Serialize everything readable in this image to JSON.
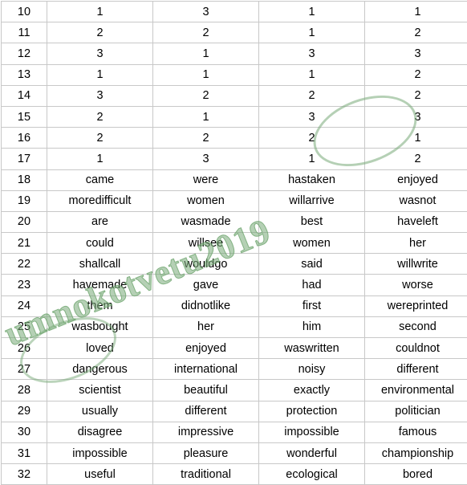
{
  "table": {
    "column_count": 5,
    "rows": [
      {
        "num": "10",
        "c1": "1",
        "c2": "3",
        "c3": "1",
        "c4": "1"
      },
      {
        "num": "11",
        "c1": "2",
        "c2": "2",
        "c3": "1",
        "c4": "2"
      },
      {
        "num": "12",
        "c1": "3",
        "c2": "1",
        "c3": "3",
        "c4": "3"
      },
      {
        "num": "13",
        "c1": "1",
        "c2": "1",
        "c3": "1",
        "c4": "2"
      },
      {
        "num": "14",
        "c1": "3",
        "c2": "2",
        "c3": "2",
        "c4": "2"
      },
      {
        "num": "15",
        "c1": "2",
        "c2": "1",
        "c3": "3",
        "c4": "3"
      },
      {
        "num": "16",
        "c1": "2",
        "c2": "2",
        "c3": "2",
        "c4": "1"
      },
      {
        "num": "17",
        "c1": "1",
        "c2": "3",
        "c3": "1",
        "c4": "2"
      },
      {
        "num": "18",
        "c1": "came",
        "c2": "were",
        "c3": "hastaken",
        "c4": "enjoyed"
      },
      {
        "num": "19",
        "c1": "moredifficult",
        "c2": "women",
        "c3": "willarrive",
        "c4": "wasnot"
      },
      {
        "num": "20",
        "c1": "are",
        "c2": "wasmade",
        "c3": "best",
        "c4": "haveleft"
      },
      {
        "num": "21",
        "c1": "could",
        "c2": "willsee",
        "c3": "women",
        "c4": "her"
      },
      {
        "num": "22",
        "c1": "shallcall",
        "c2": "wouldgo",
        "c3": "said",
        "c4": "willwrite"
      },
      {
        "num": "23",
        "c1": "havemade",
        "c2": "gave",
        "c3": "had",
        "c4": "worse"
      },
      {
        "num": "24",
        "c1": "them",
        "c2": "didnotlike",
        "c3": "first",
        "c4": "wereprinted"
      },
      {
        "num": "25",
        "c1": "wasbought",
        "c2": "her",
        "c3": "him",
        "c4": "second"
      },
      {
        "num": "26",
        "c1": "loved",
        "c2": "enjoyed",
        "c3": "waswritten",
        "c4": "couldnot"
      },
      {
        "num": "27",
        "c1": "dangerous",
        "c2": "international",
        "c3": "noisy",
        "c4": "different"
      },
      {
        "num": "28",
        "c1": "scientist",
        "c2": "beautiful",
        "c3": "exactly",
        "c4": "environmental"
      },
      {
        "num": "29",
        "c1": "usually",
        "c2": "different",
        "c3": "protection",
        "c4": "politician"
      },
      {
        "num": "30",
        "c1": "disagree",
        "c2": "impressive",
        "c3": "impossible",
        "c4": "famous"
      },
      {
        "num": "31",
        "c1": "impossible",
        "c2": "pleasure",
        "c3": "wonderful",
        "c4": "championship"
      },
      {
        "num": "32",
        "c1": "useful",
        "c2": "traditional",
        "c3": "ecological",
        "c4": "bored"
      }
    ]
  },
  "watermark": {
    "text": "umnokotvetu2019",
    "color": "#78aa78"
  }
}
